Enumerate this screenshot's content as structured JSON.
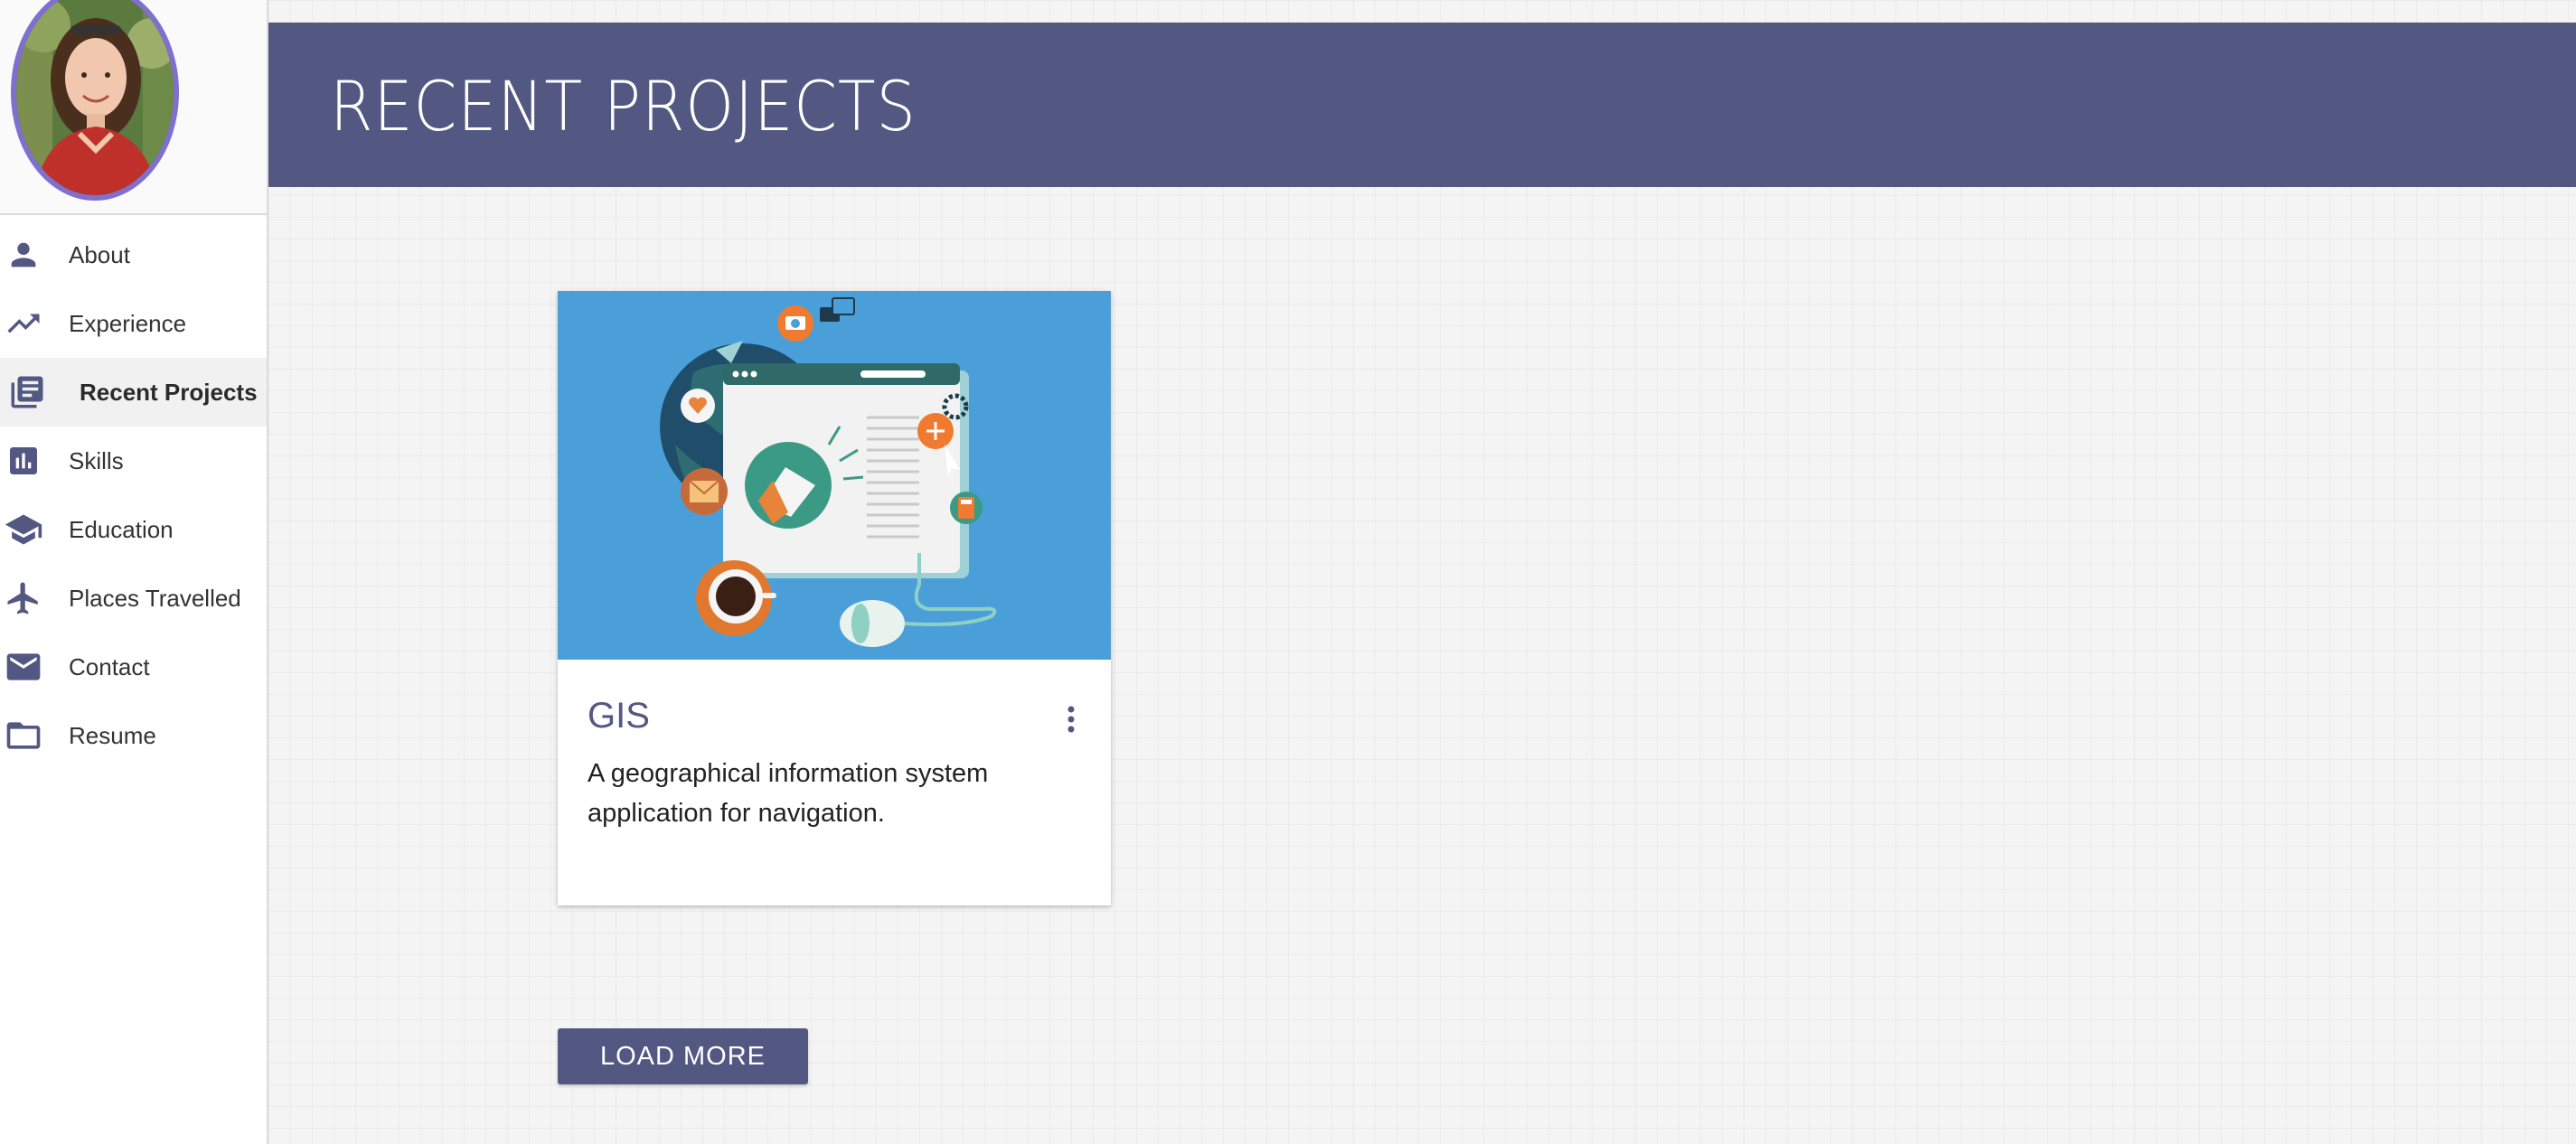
{
  "sidebar": {
    "items": [
      {
        "label": "About",
        "icon": "person-icon"
      },
      {
        "label": "Experience",
        "icon": "trending-up-icon"
      },
      {
        "label": "Recent Projects",
        "icon": "library-books-icon",
        "active": true
      },
      {
        "label": "Skills",
        "icon": "bar-chart-icon"
      },
      {
        "label": "Education",
        "icon": "school-icon"
      },
      {
        "label": "Places Travelled",
        "icon": "airplane-icon"
      },
      {
        "label": "Contact",
        "icon": "mail-icon"
      },
      {
        "label": "Resume",
        "icon": "folder-icon"
      }
    ]
  },
  "header": {
    "title": "RECENT PROJECTS"
  },
  "projects": [
    {
      "title": "GIS",
      "description": "A geographical information system application for navigation."
    }
  ],
  "actions": {
    "load_more_label": "LOAD MORE"
  },
  "colors": {
    "accent": "#525882",
    "avatar_border": "#7f6fcf",
    "card_media_bg": "#4b9fd9"
  }
}
